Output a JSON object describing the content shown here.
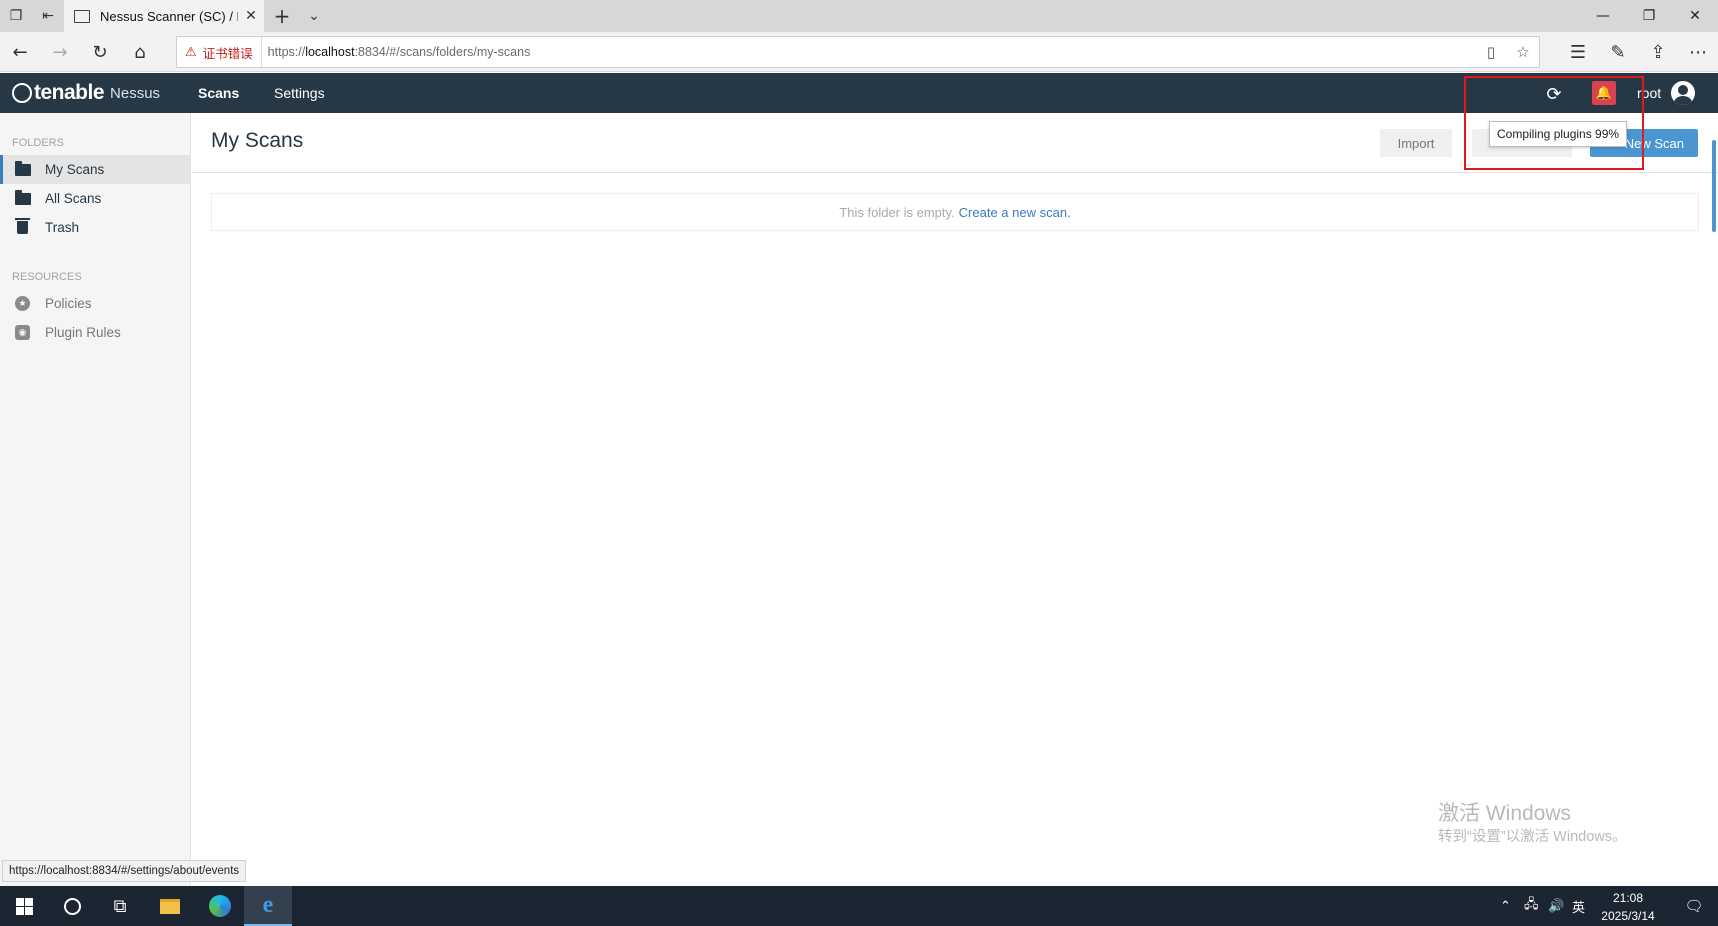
{
  "browser": {
    "tab_title": "Nessus Scanner (SC) / F",
    "cert_warning": "证书错误",
    "url_prefix": "https://",
    "url_host": "localhost",
    "url_rest": ":8834/#/scans/folders/my-scans",
    "status_url": "https://localhost:8834/#/settings/about/events"
  },
  "app": {
    "brand": "tenable",
    "product": "Nessus",
    "nav": {
      "scans": "Scans",
      "settings": "Settings"
    },
    "user": "root",
    "tooltip": "Compiling plugins 99%"
  },
  "sidebar": {
    "folders_heading": "FOLDERS",
    "folders": [
      {
        "label": "My Scans",
        "icon": "folder-open-icon"
      },
      {
        "label": "All Scans",
        "icon": "folder-icon"
      },
      {
        "label": "Trash",
        "icon": "trash-icon"
      }
    ],
    "resources_heading": "RESOURCES",
    "resources": [
      {
        "label": "Policies",
        "icon": "policy-badge-icon"
      },
      {
        "label": "Plugin Rules",
        "icon": "plugin-rules-icon"
      }
    ]
  },
  "main": {
    "title": "My Scans",
    "import_label": "Import",
    "new_scan_label": "New Scan",
    "empty_text": "This folder is empty.",
    "empty_link": "Create a new scan."
  },
  "watermark": {
    "line1": "激活 Windows",
    "line2": "转到“设置”以激活 Windows。"
  },
  "taskbar": {
    "time": "21:08",
    "date": "2025/3/14",
    "ime": "英"
  },
  "colors": {
    "nav_bg": "#263746",
    "accent": "#4a96d2",
    "alert": "#d9424e",
    "highlight": "#e0191c"
  }
}
